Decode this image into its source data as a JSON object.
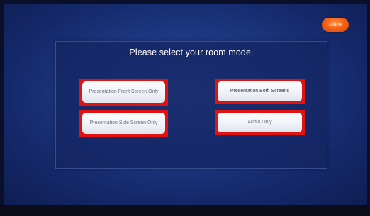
{
  "header": {
    "close_label": "Close"
  },
  "panel": {
    "title": "Please select your room mode."
  },
  "modes": {
    "front_screen": "Presentation Front Screen Only",
    "both_screens": "Presentation Both Screens",
    "side_screen": "Presentation Side Screen Only",
    "audio_only": "Audio Only"
  },
  "colors": {
    "highlight_border": "#e01212",
    "close_button": "#f05a10",
    "background": "#1f3a86"
  }
}
